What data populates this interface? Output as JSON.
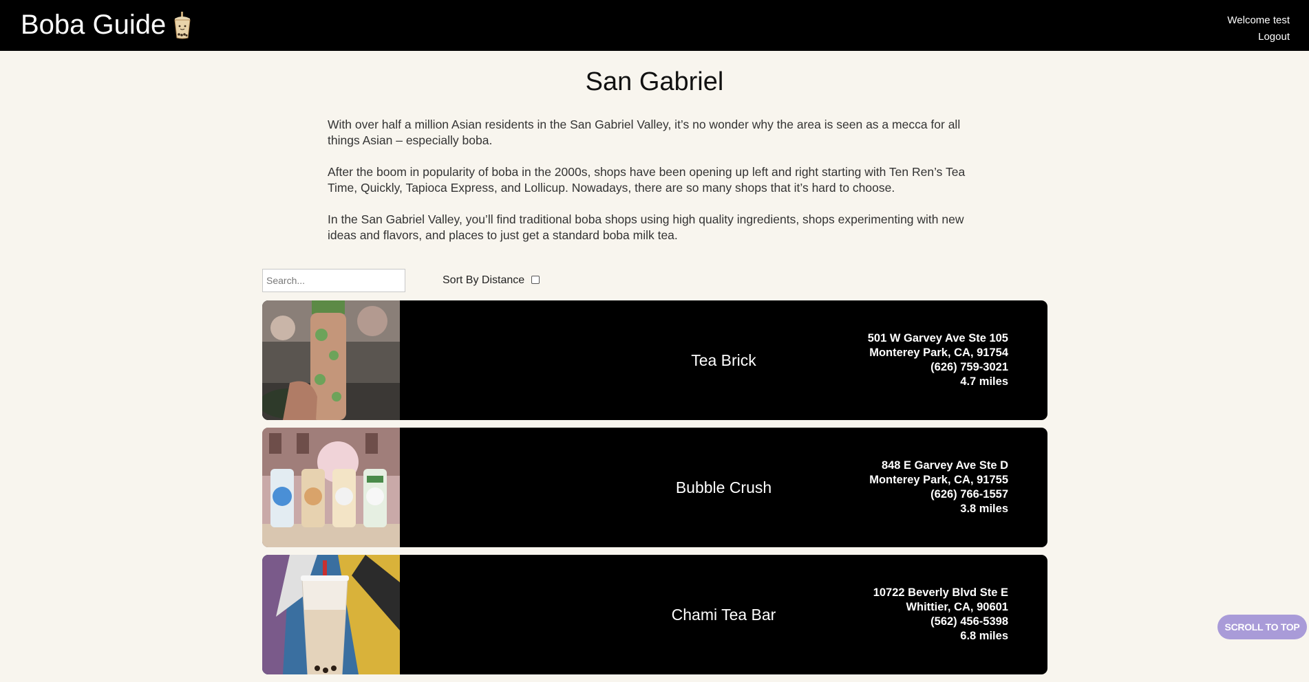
{
  "nav": {
    "brand": "Boba Guide",
    "welcome": "Welcome test",
    "logout": "Logout"
  },
  "page": {
    "title": "San Gabriel",
    "paragraphs": [
      "With over half a million Asian residents in the San Gabriel Valley, it’s no wonder why the area is seen as a mecca for all things Asian – especially boba.",
      "After the boom in popularity of boba in the 2000s, shops have been opening up left and right starting with Ten Ren’s Tea Time, Quickly, Tapioca Express, and Lollicup. Nowadays, there are so many shops that it’s hard to choose.",
      "In the San Gabriel Valley, you’ll find traditional boba shops using high quality ingredients, shops experimenting with new ideas and flavors, and places to just get a standard boba milk tea."
    ]
  },
  "controls": {
    "search_placeholder": "Search...",
    "search_value": "",
    "sort_label": "Sort By Distance",
    "sort_checked": false
  },
  "shops": [
    {
      "name": "Tea Brick",
      "address1": "501 W Garvey Ave Ste 105",
      "address2": "Monterey Park, CA, 91754",
      "phone": "(626) 759-3021",
      "distance": "4.7 miles",
      "thumb_icon": "bottle-photo-icon"
    },
    {
      "name": "Bubble Crush",
      "address1": "848 E Garvey Ave Ste D",
      "address2": "Monterey Park, CA, 91755",
      "phone": "(626) 766-1557",
      "distance": "3.8 miles",
      "thumb_icon": "character-bottles-photo-icon"
    },
    {
      "name": "Chami Tea Bar",
      "address1": "10722 Beverly Blvd Ste E",
      "address2": "Whittier, CA, 90601",
      "phone": "(562) 456-5398",
      "distance": "6.8 miles",
      "thumb_icon": "milk-tea-cup-photo-icon"
    }
  ],
  "scroll_top": "SCROLL TO TOP",
  "colors": {
    "navbar": "#000000",
    "page_bg": "#f8f5ee",
    "card_bg": "#000000",
    "scroll_button": "#a99bd8"
  }
}
